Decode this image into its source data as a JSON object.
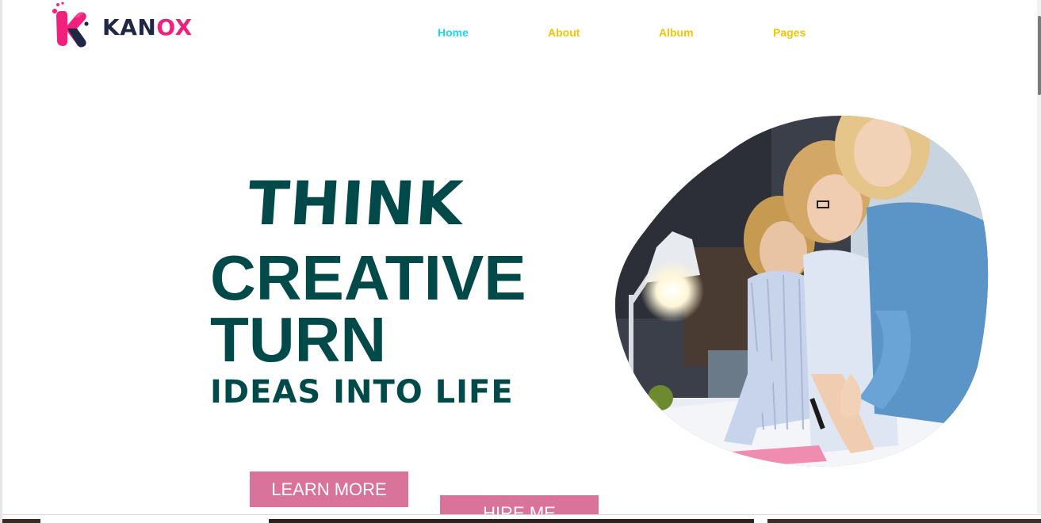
{
  "brand": {
    "name_part1": "KAN",
    "name_part2": "OX",
    "primary_color": "#1e2746",
    "accent_color": "#f0207c"
  },
  "nav": {
    "items": [
      {
        "label": "Home",
        "active": true
      },
      {
        "label": "About",
        "active": false
      },
      {
        "label": "Album",
        "active": false
      },
      {
        "label": "Pages",
        "active": false
      }
    ],
    "active_color": "#1fd6e8",
    "color": "#f2c500"
  },
  "hero": {
    "line1": "THINK",
    "line2": "CREATIVE",
    "line3": "TURN",
    "line4": "IDEAS INTO LIFE",
    "text_color": "#024a4a",
    "image_description_icon": "team-working-photo"
  },
  "buttons": {
    "learn_more": "LEARN MORE",
    "hire_me": "HIRE ME",
    "color": "#d9739a"
  }
}
